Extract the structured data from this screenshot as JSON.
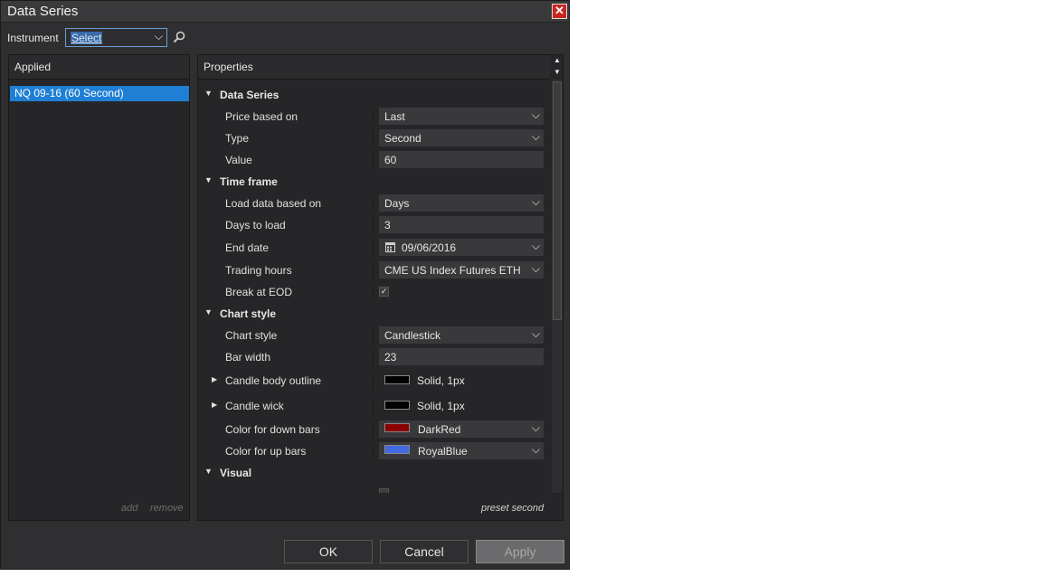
{
  "window": {
    "title": "Data Series"
  },
  "instrument": {
    "label": "Instrument",
    "value": "Select"
  },
  "applied": {
    "header": "Applied",
    "items": [
      "NQ 09-16 (60 Second)"
    ],
    "add_label": "add",
    "remove_label": "remove"
  },
  "properties": {
    "header": "Properties",
    "preset_label": "preset second",
    "sections": [
      {
        "title": "Data Series"
      },
      {
        "title": "Time frame"
      },
      {
        "title": "Chart style"
      },
      {
        "title": "Visual"
      }
    ],
    "rows": {
      "price_based_on": {
        "label": "Price based on",
        "value": "Last"
      },
      "type": {
        "label": "Type",
        "value": "Second"
      },
      "value": {
        "label": "Value",
        "value": "60"
      },
      "load_data_based_on": {
        "label": "Load data based on",
        "value": "Days"
      },
      "days_to_load": {
        "label": "Days to load",
        "value": "3"
      },
      "end_date": {
        "label": "End date",
        "value": "09/06/2016"
      },
      "trading_hours": {
        "label": "Trading hours",
        "value": "CME US Index Futures ETH"
      },
      "break_at_eod": {
        "label": "Break at EOD",
        "checked": true
      },
      "chart_style": {
        "label": "Chart style",
        "value": "Candlestick"
      },
      "bar_width": {
        "label": "Bar width",
        "value": "23"
      },
      "candle_body_outline": {
        "label": "Candle body outline",
        "value": "Solid, 1px",
        "color": "#000000"
      },
      "candle_wick": {
        "label": "Candle wick",
        "value": "Solid, 1px",
        "color": "#000000"
      },
      "color_down_bars": {
        "label": "Color for down bars",
        "value": "DarkRed",
        "color": "#8b0000"
      },
      "color_up_bars": {
        "label": "Color for up bars",
        "value": "RoyalBlue",
        "color": "#4169e1"
      }
    }
  },
  "buttons": {
    "ok": "OK",
    "cancel": "Cancel",
    "apply": "Apply"
  },
  "colors": {
    "selection": "#1f7fd4",
    "close": "#c8261f",
    "background": "#2f2f31"
  }
}
